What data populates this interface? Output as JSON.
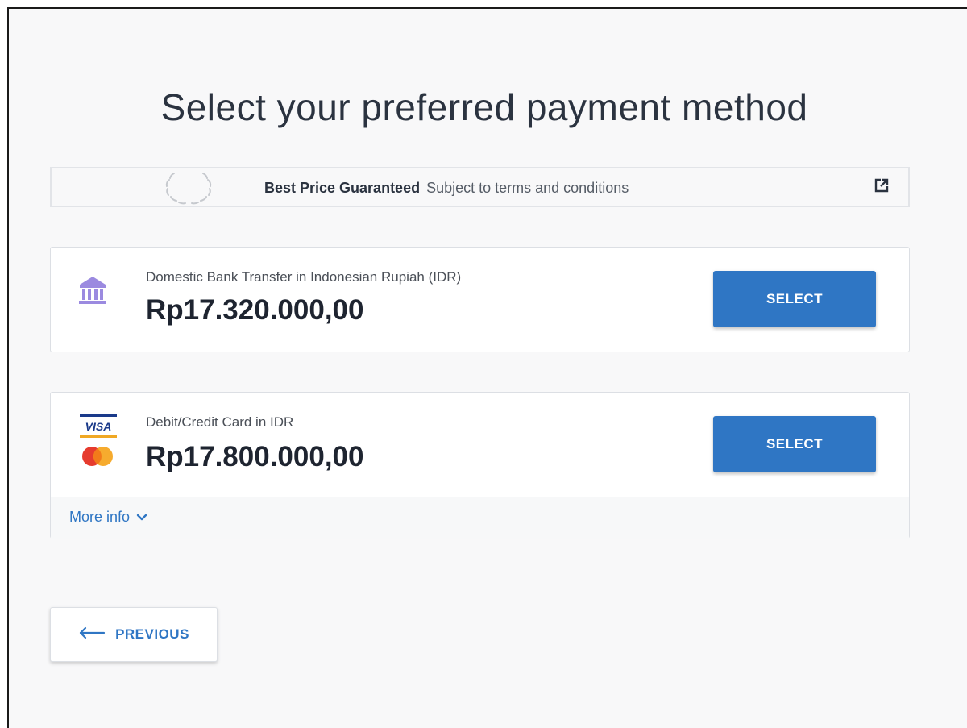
{
  "page": {
    "title": "Select your preferred payment method"
  },
  "banner": {
    "headline": "Best Price Guaranteed",
    "subtext": "Subject to terms and conditions",
    "icons": [
      "laurel-wreath-icon",
      "external-link-icon"
    ]
  },
  "payment_options": [
    {
      "label": "Domestic Bank Transfer in Indonesian Rupiah (IDR)",
      "price": "Rp17.320.000,00",
      "button_label": "SELECT",
      "icon": "bank-icon"
    },
    {
      "label": "Debit/Credit Card in IDR",
      "price": "Rp17.800.000,00",
      "button_label": "SELECT",
      "icons": [
        "visa-icon",
        "mastercard-icon"
      ],
      "visa_text": "VISA",
      "more_info_label": "More info"
    }
  ],
  "navigation": {
    "previous_label": "PREVIOUS"
  },
  "colors": {
    "accent": "#2f76c4",
    "bank_icon": "#9b8ae0",
    "title_text": "#2b3340",
    "background": "#f8f8f9"
  }
}
